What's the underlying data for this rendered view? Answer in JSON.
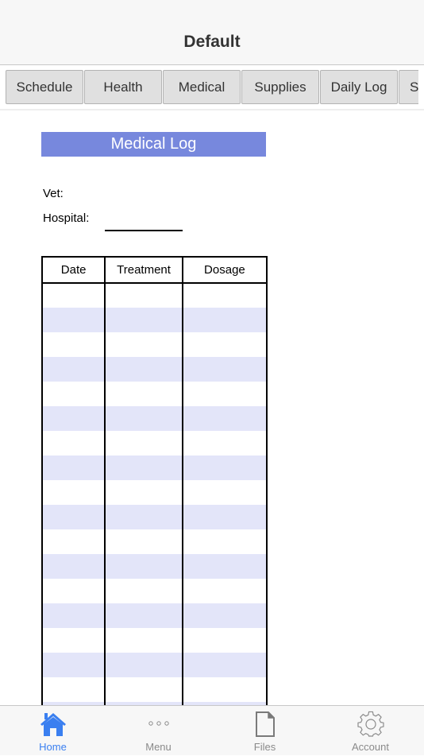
{
  "navbar": {
    "title": "Default"
  },
  "tabs": [
    {
      "label": "Schedule"
    },
    {
      "label": "Health"
    },
    {
      "label": "Medical"
    },
    {
      "label": "Supplies"
    },
    {
      "label": "Daily Log"
    },
    {
      "label": "Sy"
    }
  ],
  "medical_log": {
    "title": "Medical Log",
    "vet_label": "Vet:",
    "vet_value": "",
    "hospital_label": "Hospital:",
    "hospital_value": "",
    "table": {
      "headers": [
        "Date",
        "Treatment",
        "Dosage"
      ],
      "rows": [
        [
          "",
          "",
          ""
        ],
        [
          "",
          "",
          ""
        ],
        [
          "",
          "",
          ""
        ],
        [
          "",
          "",
          ""
        ],
        [
          "",
          "",
          ""
        ],
        [
          "",
          "",
          ""
        ],
        [
          "",
          "",
          ""
        ],
        [
          "",
          "",
          ""
        ],
        [
          "",
          "",
          ""
        ],
        [
          "",
          "",
          ""
        ],
        [
          "",
          "",
          ""
        ],
        [
          "",
          "",
          ""
        ],
        [
          "",
          "",
          ""
        ],
        [
          "",
          "",
          ""
        ],
        [
          "",
          "",
          ""
        ],
        [
          "",
          "",
          ""
        ],
        [
          "",
          "",
          ""
        ],
        [
          "",
          "",
          ""
        ]
      ]
    }
  },
  "bottom_tabs": [
    {
      "label": "Home",
      "icon": "home-icon",
      "active": true
    },
    {
      "label": "Menu",
      "icon": "more-dots-icon",
      "active": false
    },
    {
      "label": "Files",
      "icon": "file-icon",
      "active": false
    },
    {
      "label": "Account",
      "icon": "gear-icon",
      "active": false
    }
  ],
  "colors": {
    "accent": "#3a7ff0",
    "title_bar": "#7788dd",
    "row_stripe": "#e3e5f9"
  }
}
